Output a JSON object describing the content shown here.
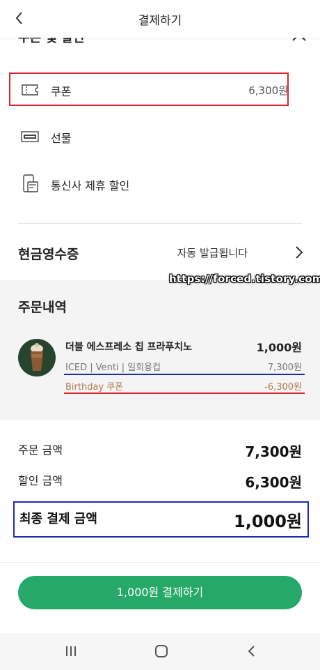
{
  "header": {
    "title": "결제하기",
    "back_icon": "chevron-left-icon"
  },
  "discount_section": {
    "title": "쿠폰 및 할인",
    "collapse_icon": "chevron-up-icon"
  },
  "discount_items": [
    {
      "label": "쿠폰",
      "value": "6,300원",
      "icon": "ticket-icon"
    },
    {
      "label": "선물",
      "icon": "gift-card-icon"
    },
    {
      "label": "통신사 제휴 할인",
      "icon": "phone-cards-icon"
    }
  ],
  "cash_receipt": {
    "label": "현금영수증",
    "value": "자동 발급됩니다",
    "icon": "chevron-right-icon"
  },
  "watermark": "https://forced.tistory.com",
  "order": {
    "title": "주문내역",
    "product": {
      "name": "더블 에스프레소 칩 프라푸치노",
      "price": "1,000원",
      "options": "ICED | Venti | 일회용컵",
      "options_price": "7,300원",
      "coupon_label": "Birthday 쿠폰",
      "coupon_value": "-6,300원"
    }
  },
  "summary": {
    "order_amount_label": "주문 금액",
    "order_amount": "7,300원",
    "discount_label": "할인 금액",
    "discount_amount": "6,300원",
    "final_label": "최종 결제 금액",
    "final_amount": "1,000원"
  },
  "pay_button": "1,000원 결제하기",
  "colors": {
    "accent_green": "#26a868",
    "annotation_red": "#d8262e",
    "annotation_blue": "#1f2bb5"
  },
  "nav": {
    "icons": [
      "recent-apps-icon",
      "home-icon",
      "back-icon"
    ]
  }
}
